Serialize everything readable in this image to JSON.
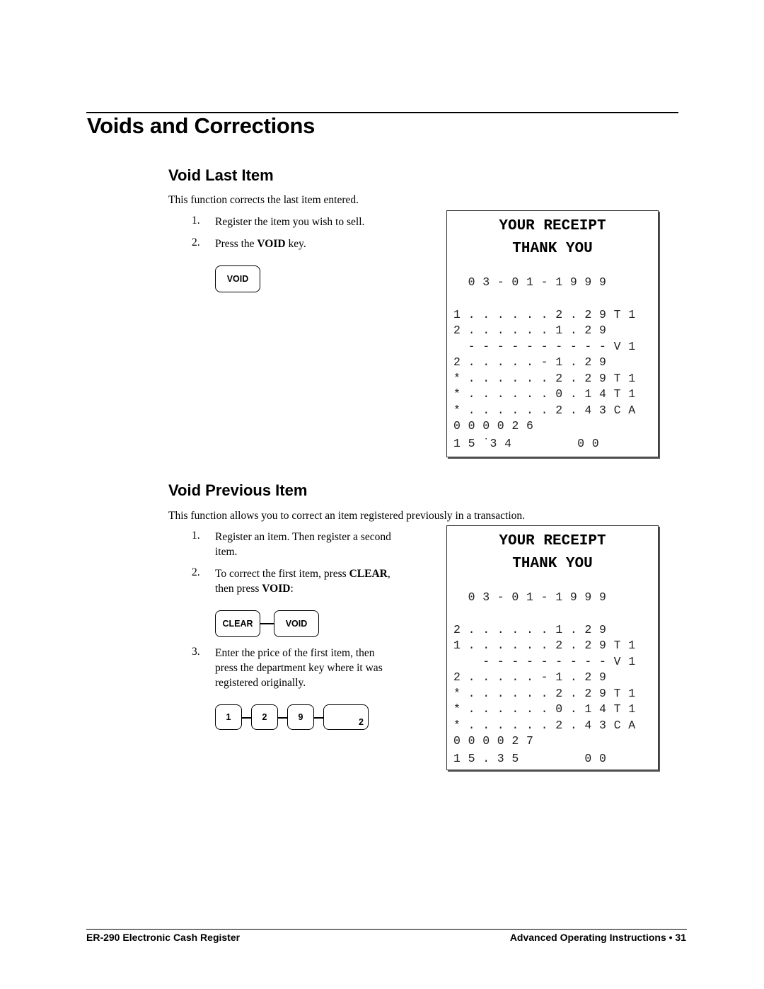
{
  "page_title": "Voids and Corrections",
  "section1": {
    "heading": "Void Last Item",
    "intro": "This function corrects the last item entered.",
    "steps": [
      {
        "n": "1.",
        "text": "Register the item you wish to sell."
      },
      {
        "n": "2.",
        "pre": "Press the ",
        "bold": "VOID",
        "post": " key."
      }
    ],
    "keys": [
      "VOID"
    ],
    "receipt": {
      "title1": "YOUR RECEIPT",
      "title2": "THANK YOU",
      "lines": [
        "  0 3 - 0 1 - 1 9 9 9",
        "",
        "1 . . . . . . 2 . 2 9 T 1",
        "2 . . . . . . 1 . 2 9",
        "  - - - - - - - - - - V 1",
        "2 . . . . . - 1 . 2 9",
        "* . . . . . . 2 . 2 9 T 1",
        "* . . . . . . 0 . 1 4 T 1",
        "* . . . . . . 2 . 4 3 C A",
        "0 0 0 0 2 6",
        "1 5 ˙3 4         0 0"
      ]
    }
  },
  "section2": {
    "heading": "Void Previous Item",
    "intro": "This function allows you to correct an item registered previously in a transaction.",
    "steps": [
      {
        "n": "1.",
        "line1": "Register an item.  Then register a second",
        "line2": "item."
      },
      {
        "n": "2.",
        "line1_pre": "To correct the first item, press ",
        "line1_bold": "CLEAR",
        "line1_post": ",",
        "line2_pre": "then press ",
        "line2_bold": "VOID",
        "line2_post": ":"
      },
      {
        "n": "3.",
        "line1": "Enter the price of the first item, then",
        "line2": "press the department key where it was",
        "line3": "registered originally."
      }
    ],
    "keys_a": [
      "CLEAR",
      "VOID"
    ],
    "keys_b": [
      "1",
      "2",
      "9",
      "2"
    ],
    "receipt": {
      "title1": "YOUR RECEIPT",
      "title2": "THANK YOU",
      "lines": [
        "  0 3 - 0 1 - 1 9 9 9",
        "",
        "2 . . . . . . 1 . 2 9",
        "1 . . . . . . 2 . 2 9 T 1",
        "    - - - - - - - - - V 1",
        "2 . . . . . - 1 . 2 9",
        "* . . . . . . 2 . 2 9 T 1",
        "* . . . . . . 0 . 1 4 T 1",
        "* . . . . . . 2 . 4 3 C A",
        "0 0 0 0 2 7",
        "1 5 . 3 5         0 0"
      ]
    }
  },
  "footer": {
    "left": "ER-290 Electronic Cash Register",
    "right": "Advanced Operating Instructions • 31"
  }
}
